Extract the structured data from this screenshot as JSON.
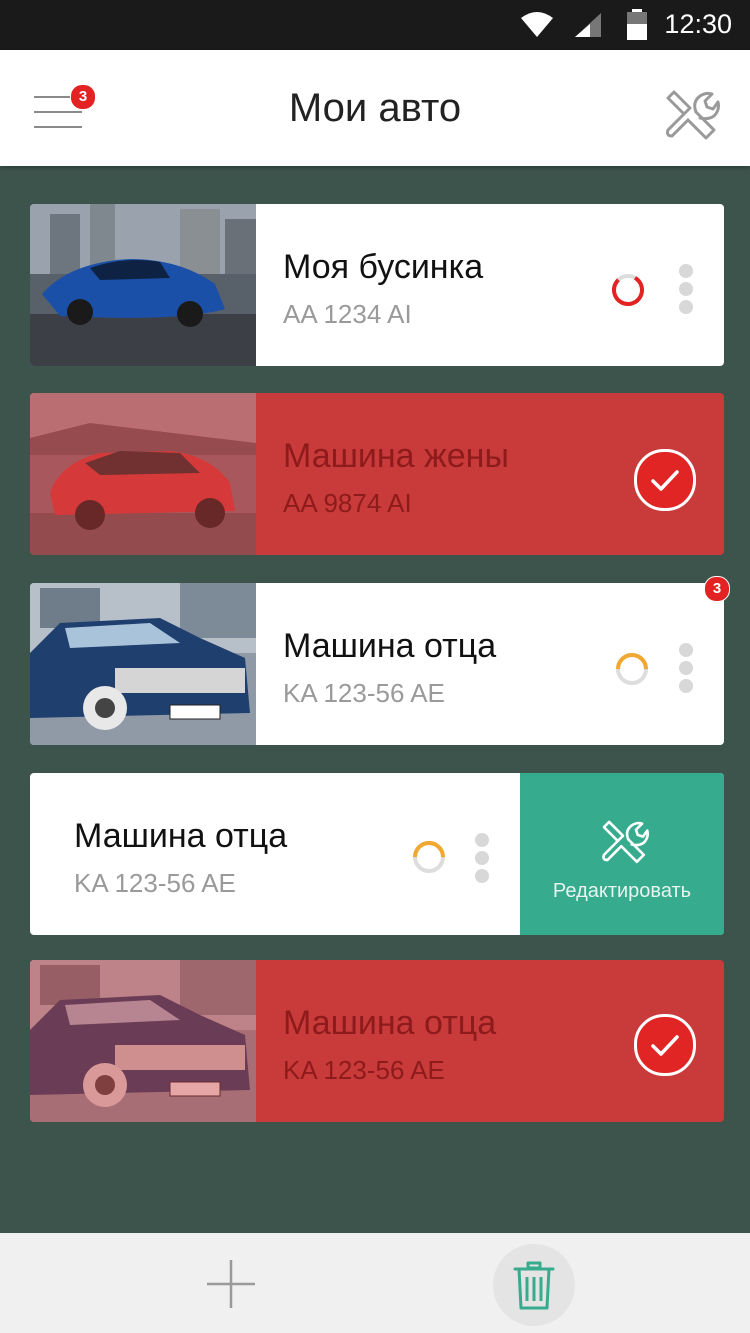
{
  "status_bar": {
    "time": "12:30",
    "icons": [
      "wifi-icon",
      "signal-icon",
      "battery-icon"
    ]
  },
  "header": {
    "title": "Мои авто",
    "menu_badge": "3",
    "menu_icon": "menu-icon",
    "settings_icon": "tools-icon"
  },
  "colors": {
    "accent_green": "#37ab8d",
    "selected_red": "#c93a3a",
    "badge_red": "#e32323",
    "background": "#3c544c"
  },
  "cars": [
    {
      "name": "Моя бусинка",
      "plate": "AA 1234 AI",
      "state": "normal",
      "status": "red-ring"
    },
    {
      "name": "Машина жены",
      "plate": "AA 9874 AI",
      "state": "selected",
      "status": "check"
    },
    {
      "name": "Машина отца",
      "plate": "KA 123-56 AE",
      "state": "normal",
      "status": "orange-ring",
      "badge": "3"
    },
    {
      "name": "Машина отца",
      "plate": "KA 123-56 AE",
      "state": "swiped",
      "status": "orange-ring",
      "action_label": "Редактировать"
    },
    {
      "name": "Машина отца",
      "plate": "KA 123-56 AE",
      "state": "selected",
      "status": "check"
    }
  ],
  "bottom_bar": {
    "add_icon": "plus-icon",
    "delete_icon": "trash-icon"
  }
}
